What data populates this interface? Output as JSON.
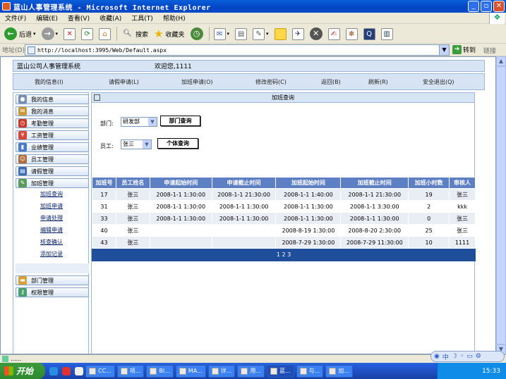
{
  "window": {
    "title": "蓝山人事管理系统 - Microsoft Internet Explorer"
  },
  "menu": [
    "文件(F)",
    "编辑(E)",
    "查看(V)",
    "收藏(A)",
    "工具(T)",
    "帮助(H)"
  ],
  "toolbar": {
    "back": "后退",
    "search": "搜索",
    "favorites": "收藏夹"
  },
  "address": {
    "label": "地址(D)",
    "url": "http://localhost:3995/Web/Default.aspx",
    "go": "转到",
    "links": "链接"
  },
  "header": {
    "system_title": "蓝山公司人事管理系统",
    "welcome": "欢迎您,1111"
  },
  "nav": [
    "我的信息(I)",
    "请假申请(L)",
    "加班申请(O)",
    "修改密码(C)",
    "返回(B)",
    "刷新(R)",
    "安全退出(Q)"
  ],
  "sidebar": {
    "items": [
      "我的信息",
      "我的消息",
      "考勤管理",
      "工资管理",
      "业绩管理",
      "员工管理",
      "请假管理",
      "加班管理"
    ],
    "sub_items": [
      "加班查询",
      "加班申请",
      "申请处理",
      "编辑申请",
      "核查确认",
      "添加记录"
    ],
    "bottom_items": [
      "部门管理",
      "权限管理"
    ]
  },
  "content": {
    "title": "加班查询",
    "dept_label": "部门:",
    "dept_value": "研发部",
    "dept_button": "部门查询",
    "emp_label": "员工:",
    "emp_value": "张三",
    "emp_button": "个体查询"
  },
  "table": {
    "headers": [
      "加班号",
      "员工姓名",
      "申请起始时间",
      "申请截止时间",
      "加班起始时间",
      "加班截止时间",
      "加班小时数",
      "审核人"
    ],
    "rows": [
      [
        "17",
        "张三",
        "2008-1-1 1:30:00",
        "2008-1-1 21:30:00",
        "2008-1-1 1:40:00",
        "2008-1-1 21:30:00",
        "19",
        "张三"
      ],
      [
        "31",
        "张三",
        "2008-1-1 1:30:00",
        "2008-1-1 1:30:00",
        "2008-1-1 1:30:00",
        "2008-1-1 3:30:00",
        "2",
        "kkk"
      ],
      [
        "33",
        "张三",
        "2008-1-1 1:30:00",
        "2008-1-1 1:30:00",
        "2008-1-1 1:30:00",
        "2008-1-1 1:30:00",
        "0",
        "张三"
      ],
      [
        "40",
        "张三",
        "",
        "",
        "2008-8-19 1:30:00",
        "2008-8-20 2:30:00",
        "25",
        "张三"
      ],
      [
        "43",
        "张三",
        "",
        "",
        "2008-7-29 1:30:00",
        "2008-7-29 11:30:00",
        "10",
        "1111"
      ]
    ],
    "pager": "1 2 3"
  },
  "status": {
    "text": "......"
  },
  "taskbar": {
    "start": "开始",
    "tasks": [
      "CC...",
      "项...",
      "Bl...",
      "MA...",
      "详...",
      "用...",
      "蓝...",
      "与...",
      "加..."
    ],
    "clock": "15:33"
  }
}
